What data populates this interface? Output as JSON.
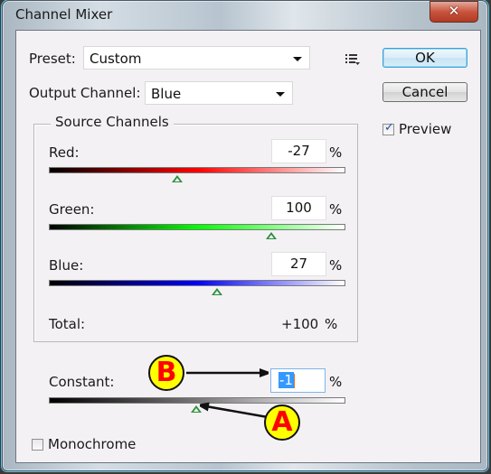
{
  "window": {
    "title": "Channel Mixer",
    "close_icon": "close-x-icon"
  },
  "preset": {
    "label": "Preset:",
    "value": "Custom",
    "menu_icon": "preset-options-icon"
  },
  "output_channel": {
    "label": "Output Channel:",
    "value": "Blue"
  },
  "buttons": {
    "ok": "OK",
    "cancel": "Cancel"
  },
  "preview": {
    "label": "Preview",
    "checked": true
  },
  "source_channels": {
    "title": "Source Channels",
    "slider_range": [
      -200,
      200
    ],
    "channels": [
      {
        "label": "Red:",
        "value": "-27",
        "unit": "%",
        "numeric": -27,
        "color": "#ff0000"
      },
      {
        "label": "Green:",
        "value": "100",
        "unit": "%",
        "numeric": 100,
        "color": "#00ff00"
      },
      {
        "label": "Blue:",
        "value": "27",
        "unit": "%",
        "numeric": 27,
        "color": "#0000ff"
      }
    ],
    "total": {
      "label": "Total:",
      "value": "+100",
      "unit": "%"
    }
  },
  "constant": {
    "label": "Constant:",
    "value": "-1",
    "unit": "%",
    "numeric": -1,
    "color": "#ffffff"
  },
  "monochrome": {
    "label": "Monochrome",
    "checked": false
  },
  "annotations": [
    {
      "letter": "B",
      "points_to": "constant-value-field"
    },
    {
      "letter": "A",
      "points_to": "constant-slider-thumb"
    }
  ]
}
